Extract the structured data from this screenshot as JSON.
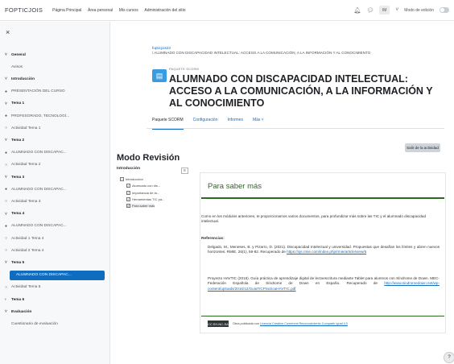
{
  "topbar": {
    "brand": "FOPTICJOIS",
    "nav": [
      "Página Principal",
      "Área personal",
      "Mis cursos",
      "Administración del sitio"
    ],
    "avatar_initials": "IM",
    "edit_mode_label": "Modo de edición",
    "icons": [
      "bell-icon",
      "chat-icon",
      "chevron-down-icon"
    ]
  },
  "sidebar": {
    "items": [
      {
        "label": "General",
        "kind": "sec",
        "marker": "˅"
      },
      {
        "label": "Avisos",
        "kind": "sub",
        "marker": ""
      },
      {
        "label": "Introducción",
        "kind": "sec",
        "marker": "˅"
      },
      {
        "label": "PRESENTACIÓN DEL CURSO",
        "kind": "sub",
        "marker": "●"
      },
      {
        "label": "Tema 1",
        "kind": "sec",
        "marker": "˅"
      },
      {
        "label": "PROFESORADO, TECNOLOGÍ...",
        "kind": "sub",
        "marker": "●"
      },
      {
        "label": "Actividad Tema 1",
        "kind": "sub",
        "marker": "○"
      },
      {
        "label": "Tema 2",
        "kind": "sec",
        "marker": "˅"
      },
      {
        "label": "ALUMNADO CON DISCAPAC...",
        "kind": "sub",
        "marker": "●"
      },
      {
        "label": "Actividad Tema 2",
        "kind": "sub",
        "marker": "○"
      },
      {
        "label": "Tema 3",
        "kind": "sec",
        "marker": "˅"
      },
      {
        "label": "ALUMNADO CON DISCAPAC...",
        "kind": "sub",
        "marker": "●"
      },
      {
        "label": "Actividad Tema 3",
        "kind": "sub",
        "marker": "○"
      },
      {
        "label": "Tema 4",
        "kind": "sec",
        "marker": "˅"
      },
      {
        "label": "ALUMNADO CON DISCAPAC...",
        "kind": "sub",
        "marker": "●"
      },
      {
        "label": "Actividad 1 Tema 4",
        "kind": "sub",
        "marker": "○"
      },
      {
        "label": "Actividad 2 Tema 4",
        "kind": "sub",
        "marker": "○"
      },
      {
        "label": "Tema 5",
        "kind": "sec",
        "marker": "˅"
      },
      {
        "label": "ALUMNADO CON DISCAPAC...",
        "kind": "active",
        "marker": ""
      },
      {
        "label": "Actividad Tema 5",
        "kind": "sub",
        "marker": "○"
      },
      {
        "label": "Tema 6",
        "kind": "sec",
        "marker": "›"
      },
      {
        "label": "Evaluación",
        "kind": "sec",
        "marker": "˅"
      },
      {
        "label": "Cuestionario de evaluación",
        "kind": "sub",
        "marker": ""
      }
    ]
  },
  "breadcrumb": {
    "course": "fopticjois23",
    "path": "/ ALUMNADO CON DISCAPACIDAD INTELECTUAL: ACCESO A LA COMUNICACIÓN, A LA INFORMACIÓN Y AL CONOCIMIENTO"
  },
  "page": {
    "package_label": "PAQUETE SCORM",
    "title": "ALUMNADO CON DISCAPACIDAD INTELECTUAL: ACCESO A LA COMUNICACIÓN, A LA INFORMACIÓN Y AL CONOCIMIENTO"
  },
  "tabs": [
    {
      "label": "Paquete SCORM",
      "active": true
    },
    {
      "label": "Configuración",
      "active": false
    },
    {
      "label": "Informes",
      "active": false
    },
    {
      "label": "Más ˅",
      "active": false
    }
  ],
  "exit_button": "Salir de la actividad",
  "review_title": "Modo Revisión",
  "toc": {
    "heading": "Introducción",
    "collapse_label": "≡",
    "items": [
      {
        "label": "Introducción",
        "level": 0,
        "selected": false
      },
      {
        "label": "Alumnado con dis...",
        "level": 1,
        "selected": false
      },
      {
        "label": "Importancia de la...",
        "level": 1,
        "selected": false
      },
      {
        "label": "Herramientas TIC pa...",
        "level": 1,
        "selected": false
      },
      {
        "label": "Para saber más",
        "level": 1,
        "selected": true
      }
    ]
  },
  "sco": {
    "title": "Para saber más",
    "intro": "Como en los módulos anteriores, te proporcionamos varios documentos, para profundizar más sobre las TIC y el alumnado discapacidad intelectual.",
    "refs_heading": "Referencias:",
    "refs": [
      {
        "text": "Delgado, M., Meneses, B. y Pizarro, D. (2021). Discapacidad Intelectual y universidad. Propuestas que desafían los límites y abren nuevos horizontes. RMIE, 26(1), 56-82. Recuperado de ",
        "url": "https://ojs.rmie.com/index.php/rmie/article/view/6"
      },
      {
        "text": "Proyecto HAVTIC (2016). Guía práctica de aprendizaje digital de lectoescritura mediante Tablet para alumnos con Síndrome de Down. MEC-Federación Española de Síndrome de Down en España. Recuperado de ",
        "url": "http://www.sindromedown.net/wp-content/uploads/2016/12/GuiaTICPracticaHAVTIC.pdf"
      }
    ],
    "license_badge": "CC BY-NC-SA",
    "license_text": "Obra publicada con ",
    "license_link": "Licencia Creative Commons Reconocimiento Compartir igual 4.0"
  },
  "help_label": "?"
}
